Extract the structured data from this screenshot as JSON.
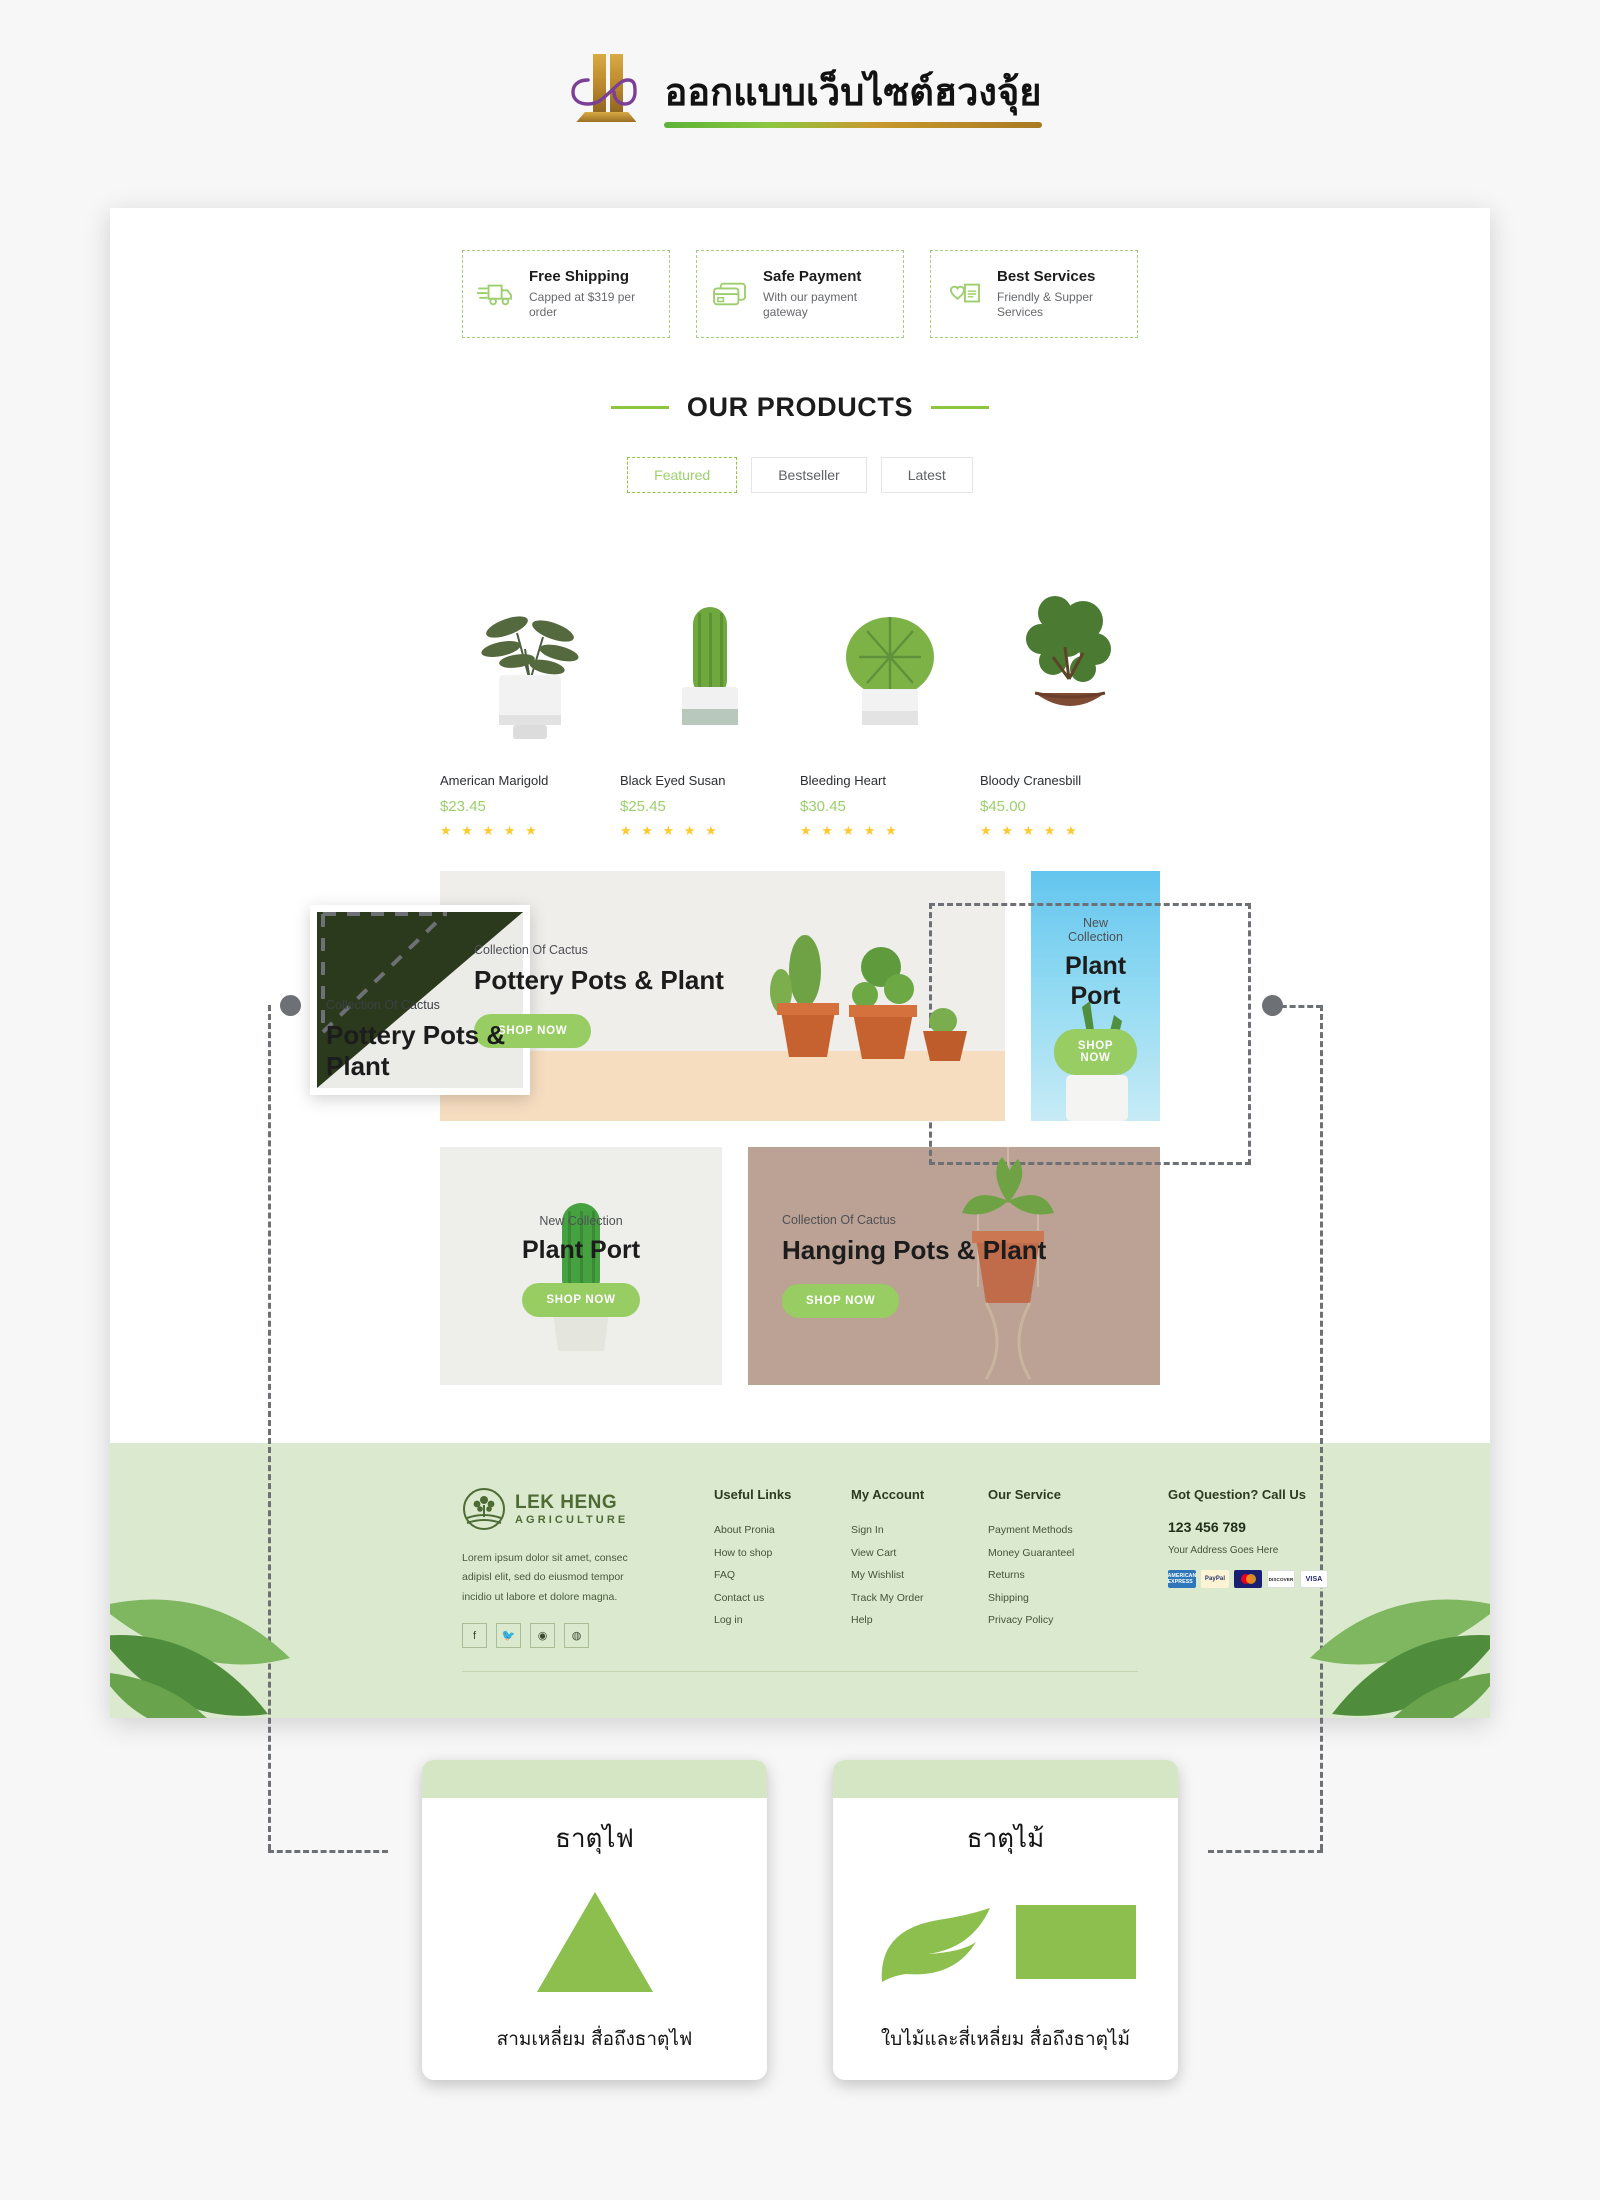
{
  "header": {
    "title": "ออกแบบเว็บไซต์ฮวงจุ้ย",
    "logo_icon": "infinity-pillar-logo"
  },
  "features": [
    {
      "icon": "truck-icon",
      "title": "Free Shipping",
      "sub": "Capped at $319 per order"
    },
    {
      "icon": "credit-card-icon",
      "title": "Safe Payment",
      "sub": "With our payment gateway"
    },
    {
      "icon": "heart-card-icon",
      "title": "Best Services",
      "sub": "Friendly & Supper Services"
    }
  ],
  "section": {
    "heading": "OUR PRODUCTS",
    "tabs": [
      {
        "label": "Featured",
        "active": true
      },
      {
        "label": "Bestseller",
        "active": false
      },
      {
        "label": "Latest",
        "active": false
      }
    ]
  },
  "products": [
    {
      "name": "American Marigold",
      "price": "$23.45",
      "stars": "★ ★ ★ ★ ★",
      "image": "leafy-plant-white-pot"
    },
    {
      "name": "Black Eyed Susan",
      "price": "$25.45",
      "stars": "★ ★ ★ ★ ★",
      "image": "tall-cactus-white-pot"
    },
    {
      "name": "Bleeding Heart",
      "price": "$30.45",
      "stars": "★ ★ ★ ★ ★",
      "image": "round-cactus-white-pot"
    },
    {
      "name": "Bloody Cranesbill",
      "price": "$45.00",
      "stars": "★ ★ ★ ★ ★",
      "image": "bonsai-dark-bowl"
    }
  ],
  "banners": {
    "pottery": {
      "sub": "Collection Of Cactus",
      "title": "Pottery Pots & Plant",
      "button": "SHOP NOW"
    },
    "plant_port_right": {
      "sub": "New Collection",
      "title": "Plant Port",
      "button": "SHOP NOW"
    },
    "plant_port_bottom": {
      "sub": "New Collection",
      "title": "Plant Port",
      "button": "SHOP NOW"
    },
    "hanging": {
      "sub": "Collection Of Cactus",
      "title": "Hanging Pots & Plant",
      "button": "SHOP NOW"
    }
  },
  "footer": {
    "brand_name": "LEK HENG",
    "brand_sub": "AGRICULTURE",
    "about": "Lorem ipsum dolor sit amet, consec adipisl elit, sed do eiusmod tempor incidio ut labore et dolore magna.",
    "socials": [
      {
        "icon": "facebook-icon",
        "glyph": "f"
      },
      {
        "icon": "twitter-icon",
        "glyph": "🐦"
      },
      {
        "icon": "pinterest-icon",
        "glyph": "◉"
      },
      {
        "icon": "dribbble-icon",
        "glyph": "◍"
      }
    ],
    "columns": [
      {
        "head": "Useful Links",
        "links": [
          "About Pronia",
          "How to shop",
          "FAQ",
          "Contact us",
          "Log in"
        ]
      },
      {
        "head": "My Account",
        "links": [
          "Sign In",
          "View Cart",
          "My Wishlist",
          "Track My Order",
          "Help"
        ]
      },
      {
        "head": "Our Service",
        "links": [
          "Payment Methods",
          "Money Guaranteel",
          "Returns",
          "Shipping",
          "Privacy Policy"
        ]
      }
    ],
    "contact": {
      "head": "Got Question? Call Us",
      "phone": "123 456 789",
      "address": "Your Address Goes Here",
      "cards": [
        {
          "name": "american-express",
          "label": "AMERICAN EXPRESS",
          "bg": "#2e77bb"
        },
        {
          "name": "paypal",
          "label": "PayPal",
          "bg": "#fdf3d5"
        },
        {
          "name": "mastercard",
          "label": "",
          "bg": "#1a1f71"
        },
        {
          "name": "discover",
          "label": "DISCOVER",
          "bg": "#ffffff"
        },
        {
          "name": "visa",
          "label": "VISA",
          "bg": "#ffffff"
        }
      ]
    }
  },
  "annotations": {
    "fire": {
      "title": "ธาตุไฟ",
      "caption": "สามเหลี่ยม สื่อถึงธาตุไฟ",
      "shape": "triangle"
    },
    "wood": {
      "title": "ธาตุไม้",
      "caption": "ใบไม้และสี่เหลี่ยม สื่อถึงธาตุไม้",
      "shape": "leaf-and-rectangle"
    }
  },
  "colors": {
    "accent_green": "#8cc63f",
    "button_green": "#97cd63",
    "footer_bg": "#dbeace",
    "shape_green": "#8cbf4d",
    "annotation_gray": "#6d7074",
    "star_yellow": "#ffc92e"
  }
}
